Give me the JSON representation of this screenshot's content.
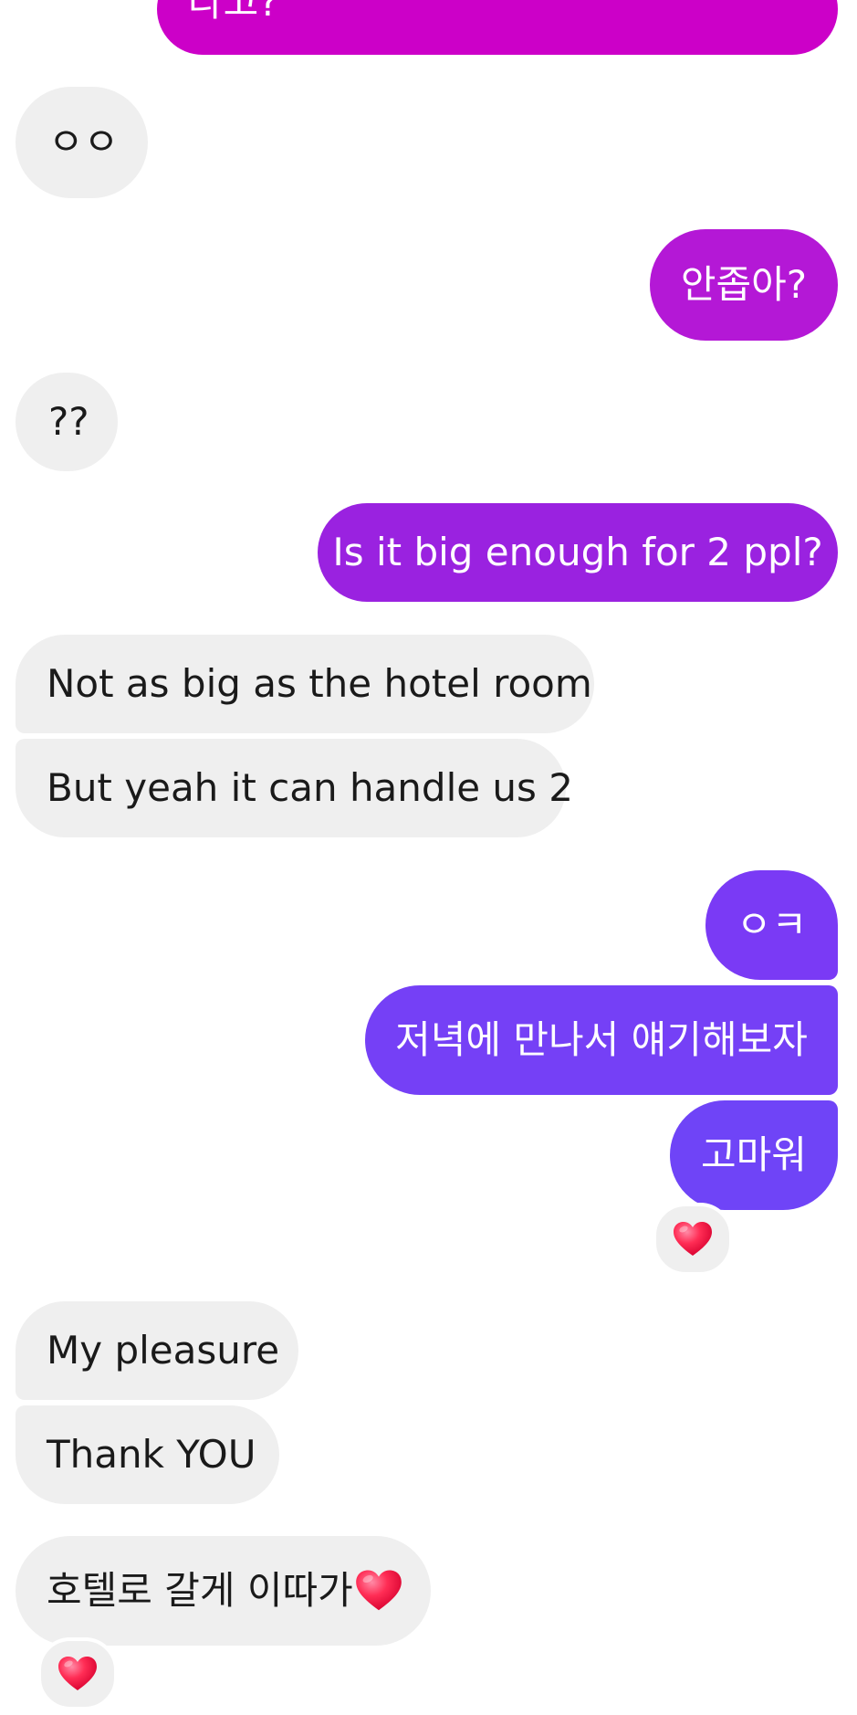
{
  "messages": [
    {
      "id": "m0",
      "side": "sent",
      "text": "라고?"
    },
    {
      "id": "m1",
      "side": "received",
      "text": "ㅇㅇ"
    },
    {
      "id": "m2",
      "side": "sent",
      "text": "안좁아?"
    },
    {
      "id": "m3",
      "side": "received",
      "text": "??"
    },
    {
      "id": "m4",
      "side": "sent",
      "text": "Is it big enough for 2 ppl?"
    },
    {
      "id": "m5",
      "side": "received",
      "text": "Not as big as the hotel room"
    },
    {
      "id": "m6",
      "side": "received",
      "text": "But yeah it can handle us 2"
    },
    {
      "id": "m7",
      "side": "sent",
      "text": "ㅇㅋ"
    },
    {
      "id": "m8",
      "side": "sent",
      "text": "저녁에 만나서 얘기해보자"
    },
    {
      "id": "m9",
      "side": "sent",
      "text": "고마워",
      "reaction": "heart"
    },
    {
      "id": "m10",
      "side": "received",
      "text": "My pleasure"
    },
    {
      "id": "m11",
      "side": "received",
      "text": "Thank YOU"
    },
    {
      "id": "m12",
      "side": "received",
      "text": "호텔로 갈게 이따가",
      "inline_emoji": "heart",
      "reaction": "heart"
    }
  ],
  "colors": {
    "received_bg": "#efefef",
    "received_text": "#1a1a1a",
    "sent_text": "#ffffff",
    "sent_gradient": [
      "#cc00c8",
      "#b418d6",
      "#9a22e0",
      "#7a3af5",
      "#6f44f7"
    ],
    "heart": "#ff2d55"
  }
}
